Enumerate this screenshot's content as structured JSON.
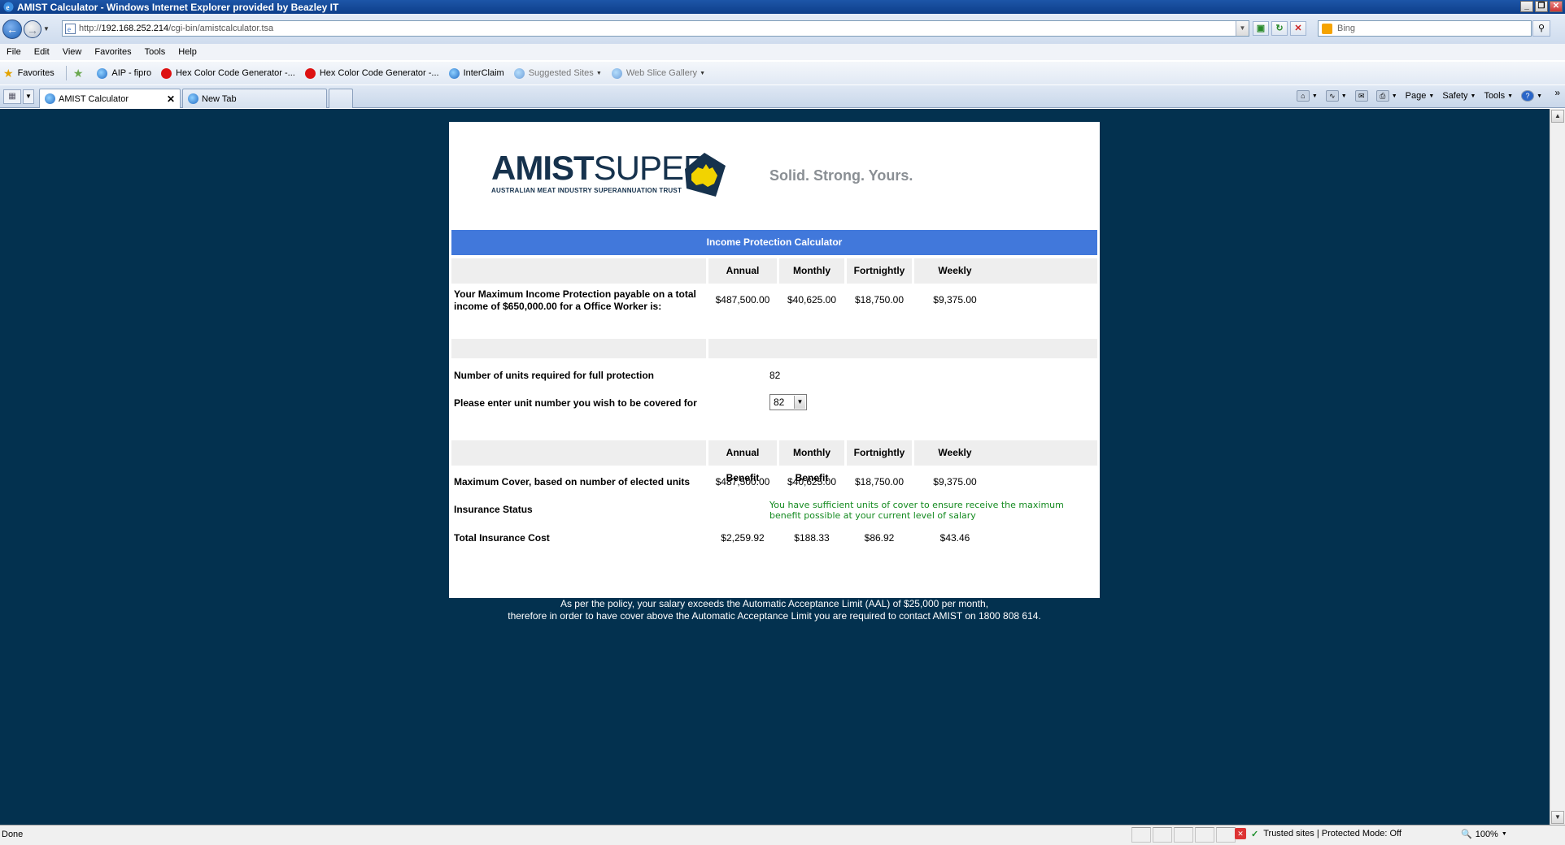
{
  "window": {
    "title": "AMIST Calculator - Windows Internet Explorer provided by Beazley IT",
    "controls": [
      "_",
      "❐",
      "✕"
    ]
  },
  "addressbar": {
    "url_prefix": "http://",
    "url_host": "192.168.252.214",
    "url_path": "/cgi-bin/amistcalculator.tsa",
    "search_placeholder": "Bing"
  },
  "menu": {
    "items": [
      "File",
      "Edit",
      "View",
      "Favorites",
      "Tools",
      "Help"
    ]
  },
  "favorites": {
    "label": "Favorites",
    "items": [
      "AIP - fipro",
      "Hex Color Code Generator -...",
      "Hex Color Code Generator -...",
      "InterClaim",
      "Suggested Sites",
      "Web Slice Gallery"
    ]
  },
  "tabs": {
    "active": "AMIST Calculator",
    "inactive": "New Tab"
  },
  "commandbar": {
    "page": "Page",
    "safety": "Safety",
    "tools": "Tools"
  },
  "page": {
    "logo_bold": "AMIST",
    "logo_light": "SUPER",
    "logo_sub": "AUSTRALIAN MEAT INDUSTRY SUPERANNUATION TRUST",
    "tagline": "Solid. Strong. Yours.",
    "calc_title": "Income Protection Calculator",
    "table1": {
      "headers": [
        "Annual",
        "Monthly",
        "Fortnightly",
        "Weekly"
      ],
      "row_label": "Your Maximum Income Protection payable on a total income of $650,000.00 for a Office Worker is:",
      "values": [
        "$487,500.00",
        "$40,625.00",
        "$18,750.00",
        "$9,375.00"
      ]
    },
    "units": {
      "required_label": "Number of units required for full protection",
      "required_value": "82",
      "enter_label": "Please enter unit number you wish to be covered for",
      "selected": "82"
    },
    "table2": {
      "headers": [
        "Annual Benefit",
        "Monthly Benefit",
        "Fortnightly",
        "Weekly"
      ],
      "max_cover_label": "Maximum Cover, based on number of elected units",
      "max_cover_values": [
        "$487,500.00",
        "$40,625.00",
        "$18,750.00",
        "$9,375.00"
      ],
      "status_label": "Insurance Status",
      "status_line1": "You have sufficient units of cover to ensure receive the maximum",
      "status_line2": "benefit possible at your current level of salary",
      "cost_label": "Total Insurance Cost",
      "cost_values": [
        "$2,259.92",
        "$188.33",
        "$86.92",
        "$43.46"
      ]
    },
    "note_line1": "As per the policy, your salary exceeds the Automatic Acceptance Limit (AAL) of $25,000 per month,",
    "note_line2": "therefore in order to have cover above the Automatic Acceptance Limit you are required to contact AMIST on 1800 808 614."
  },
  "statusbar": {
    "status": "Done",
    "zone": "Trusted sites | Protected Mode: Off",
    "zoom": "100%"
  },
  "colors": {
    "page_bg": "#03314f",
    "header_blue": "#4178db",
    "status_green": "#138a1f",
    "logo_navy": "#16324d",
    "logo_yellow": "#f2d300"
  }
}
